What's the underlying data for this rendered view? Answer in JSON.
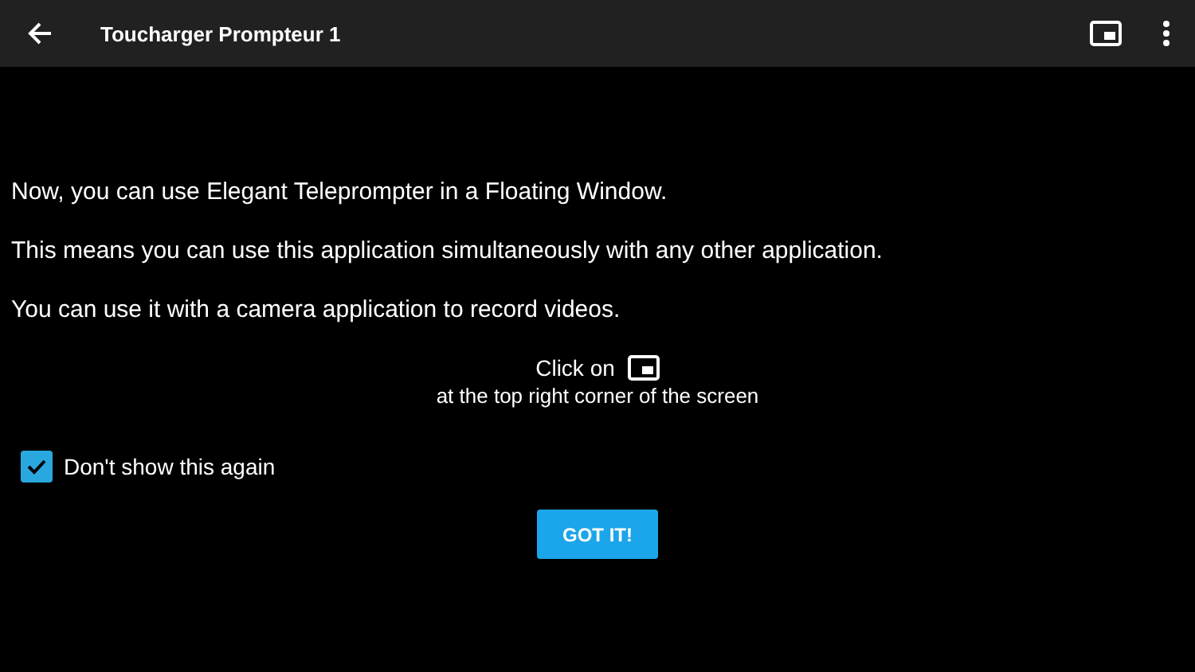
{
  "app_bar": {
    "title": "Toucharger Prompteur 1"
  },
  "paragraphs": [
    "Now, you can use Elegant Teleprompter in a Floating Window.",
    "This means you can use this application simultaneously with any other application.",
    "You can use it with a camera application to record videos."
  ],
  "instruction": {
    "lead": "Click on",
    "detail": "at the top right corner of the screen"
  },
  "checkbox": {
    "label": "Don't show this again",
    "checked": true
  },
  "button": {
    "label": "GOT IT!"
  }
}
